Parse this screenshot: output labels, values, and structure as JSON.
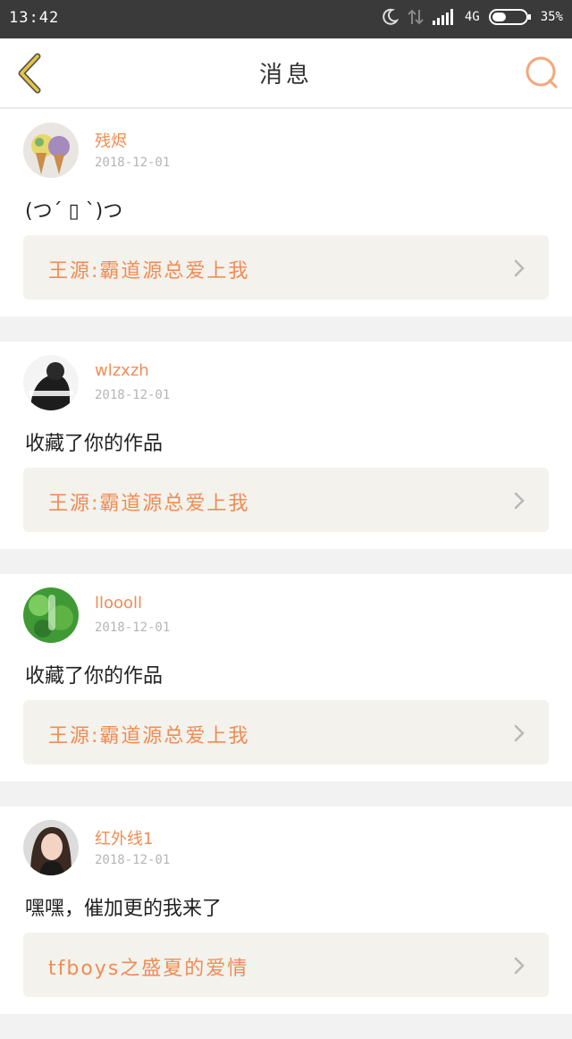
{
  "status_bar": {
    "time": "13:42",
    "network": "4G",
    "battery": "35%"
  },
  "header": {
    "title": "消息"
  },
  "colors": {
    "accent": "#f08c55",
    "back_arrow": "#e8c440",
    "card_bg": "#f3f2ec"
  },
  "messages": [
    {
      "username": "残烬",
      "date": "2018-12-01",
      "text": "(つ´ ▯ `)つ",
      "work": "王源:霸道源总爱上我"
    },
    {
      "username": "wlzxzh",
      "date": "2018-12-01",
      "text": "收藏了你的作品",
      "work": "王源:霸道源总爱上我"
    },
    {
      "username": "lloooll",
      "date": "2018-12-01",
      "text": "收藏了你的作品",
      "work": "王源:霸道源总爱上我"
    },
    {
      "username": "红外线1",
      "date": "2018-12-01",
      "text": "嘿嘿，催加更的我来了",
      "work": "tfboys之盛夏的爱情"
    }
  ]
}
